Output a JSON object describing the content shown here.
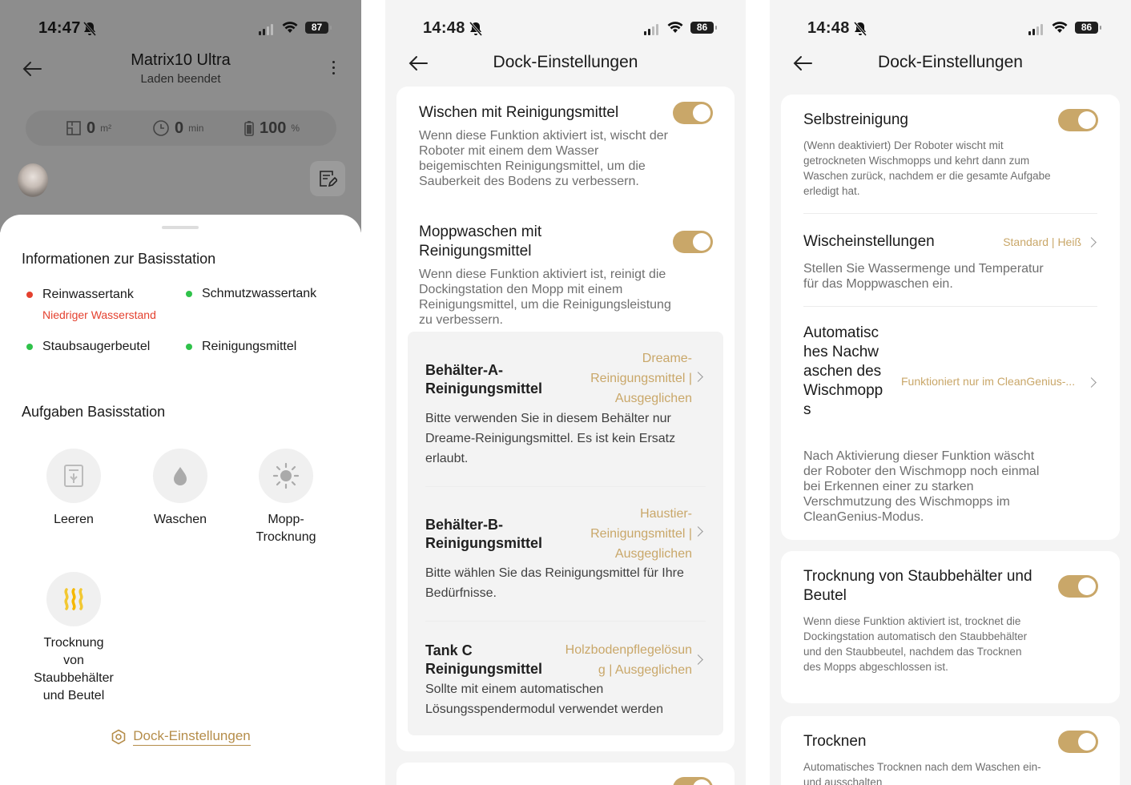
{
  "screen1": {
    "time": "14:47",
    "battery": "87",
    "title": "Matrix10 Ultra",
    "subtitle": "Laden beendet",
    "stats": [
      {
        "value": "0",
        "unit": "m²",
        "icon": "area-icon"
      },
      {
        "value": "0",
        "unit": "min",
        "icon": "clock-icon"
      },
      {
        "value": "100",
        "unit": "%",
        "icon": "battery-icon"
      }
    ],
    "info_heading": "Informationen zur Basisstation",
    "tanks": [
      {
        "label": "Reinwassertank",
        "warning": "Niedriger Wasserstand",
        "status": "red"
      },
      {
        "label": "Schmutzwassertank",
        "status": "green"
      },
      {
        "label": "Staubsaugerbeutel",
        "status": "green"
      },
      {
        "label": "Reinigungsmittel",
        "status": "green"
      }
    ],
    "tasks_heading": "Aufgaben Basisstation",
    "tasks": [
      {
        "label": "Leeren",
        "icon": "empty-bin-icon"
      },
      {
        "label": "Waschen",
        "icon": "water-drop-icon"
      },
      {
        "label": "Mopp-Trocknung",
        "icon": "sun-icon"
      },
      {
        "label": "Trocknung von Staubbehälter und Beutel",
        "icon": "heat-waves-icon"
      }
    ],
    "dock_link": "Dock-Einstellungen"
  },
  "screen2": {
    "time": "14:48",
    "battery": "86",
    "title": "Dock-Einstellungen",
    "wipe_title": "Wischen mit Reinigungsmittel",
    "wipe_desc": "Wenn diese Funktion aktiviert ist, wischt der Roboter mit einem dem Wasser beigemischten Reinigungsmittel, um die Sauberkeit des Bodens zu verbessern.",
    "wipe_on": true,
    "mopwash_title": "Moppwaschen mit Reinigungsmittel",
    "mopwash_desc": "Wenn diese Funktion aktiviert ist, reinigt die Dockingstation den Mopp mit einem Reinigungsmittel, um die Reinigungsleistung zu verbessern.",
    "mopwash_on": true,
    "containers": [
      {
        "title": "Behälter-A-Reinigungsmittel",
        "value": "Dreame-Reinigungsmittel | Ausgeglichen",
        "desc": "Bitte verwenden Sie in diesem Behälter nur Dreame-Reinigungsmittel. Es ist kein Ersatz erlaubt."
      },
      {
        "title": "Behälter-B-Reinigungsmittel",
        "value": "Haustier-Reinigungsmittel | Ausgeglichen",
        "desc": "Bitte wählen Sie das Reinigungsmittel für Ihre Bedürfnisse."
      },
      {
        "title": "Tank C Reinigungsmittel",
        "value": "Holzbodenpflegelösung | Ausgeglichen",
        "desc": "Sollte mit einem automatischen Lösungsspendermodul verwendet werden"
      }
    ]
  },
  "screen3": {
    "time": "14:48",
    "battery": "86",
    "title": "Dock-Einstellungen",
    "self_title": "Selbstreinigung",
    "self_desc": "(Wenn deaktiviert) Der Roboter wischt mit getrockneten Wischmopps und kehrt dann zum Waschen zurück, nachdem er die gesamte Aufgabe erledigt hat.",
    "self_on": true,
    "wash_title": "Wischeinstellungen",
    "wash_value": "Standard | Heiß",
    "wash_desc": "Stellen Sie Wassermenge und Temperatur für das Moppwaschen ein.",
    "auto_title": "Automatisches Nachwaschen des Wischmopps",
    "auto_value": "Funktioniert nur im CleanGenius-...",
    "auto_desc": "Nach Aktivierung dieser Funktion wäscht der Roboter den Wischmopp noch einmal bei Erkennen einer zu starken Verschmutzung des Wischmopps im CleanGenius-Modus.",
    "dry_title": "Trocknung von Staubbehälter und Beutel",
    "dry_desc": "Wenn diese Funktion aktiviert ist, trocknet die Dockingstation automatisch den Staubbehälter und den Staubbeutel, nachdem das Trocknen des Mopps abgeschlossen ist.",
    "dry_on": true,
    "dry2_title": "Trocknen",
    "dry2_desc": "Automatisches Trocknen nach dem Waschen ein- und ausschalten",
    "dry2_on": true
  },
  "colors": {
    "accent": "#c9a769",
    "link": "#b58d4a",
    "warning": "#e4412f",
    "ok": "#2fc24a"
  }
}
